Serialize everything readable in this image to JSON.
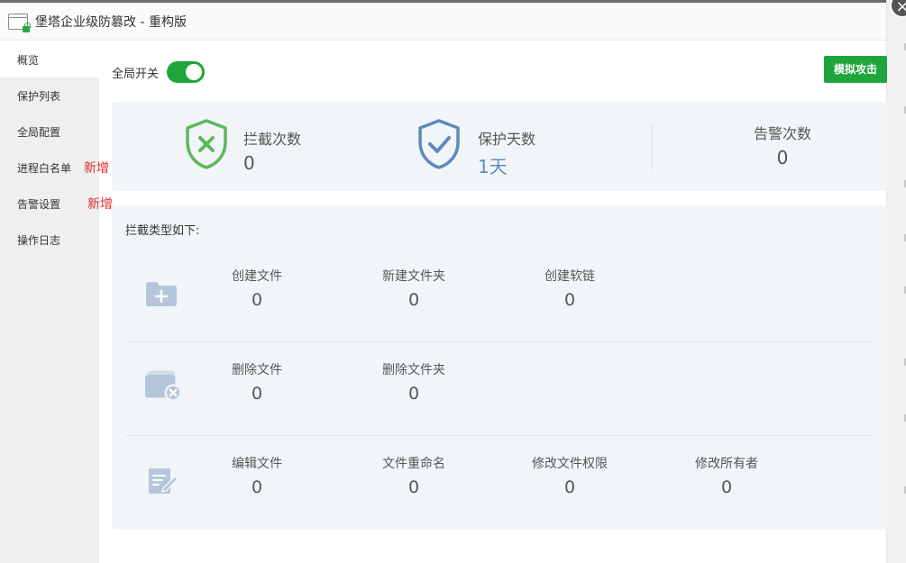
{
  "window": {
    "title": "堡塔企业级防篡改 - 重构版",
    "close_glyph": "×"
  },
  "sidebar": {
    "items": [
      {
        "label": "概览",
        "active": true,
        "badge": ""
      },
      {
        "label": "保护列表",
        "active": false,
        "badge": ""
      },
      {
        "label": "全局配置",
        "active": false,
        "badge": ""
      },
      {
        "label": "进程白名单",
        "active": false,
        "badge": "新增"
      },
      {
        "label": "告警设置",
        "active": false,
        "badge": "新增"
      },
      {
        "label": "操作日志",
        "active": false,
        "badge": ""
      }
    ]
  },
  "header": {
    "switch_label": "全局开关",
    "switch_on": true,
    "attack_button": "模拟攻击"
  },
  "stats": {
    "blocked": {
      "label": "拦截次数",
      "value": "0"
    },
    "protected": {
      "label": "保护天数",
      "value": "1天"
    },
    "alerts": {
      "label": "告警次数",
      "value": "0"
    }
  },
  "types": {
    "title": "拦截类型如下:",
    "rows": [
      {
        "icon": "folder-add-icon",
        "items": [
          {
            "label": "创建文件",
            "value": "0"
          },
          {
            "label": "新建文件夹",
            "value": "0"
          },
          {
            "label": "创建软链",
            "value": "0"
          }
        ]
      },
      {
        "icon": "folder-delete-icon",
        "items": [
          {
            "label": "删除文件",
            "value": "0"
          },
          {
            "label": "删除文件夹",
            "value": "0"
          }
        ]
      },
      {
        "icon": "edit-file-icon",
        "items": [
          {
            "label": "编辑文件",
            "value": "0"
          },
          {
            "label": "文件重命名",
            "value": "0"
          },
          {
            "label": "修改文件权限",
            "value": "0"
          },
          {
            "label": "修改所有者",
            "value": "0"
          }
        ]
      }
    ]
  },
  "colors": {
    "accent_green": "#20a53a",
    "badge_red": "#e02d2d",
    "shield_green": "#5cb85c",
    "shield_blue": "#5b8bbf",
    "icon_blue": "#b5c6dc"
  }
}
